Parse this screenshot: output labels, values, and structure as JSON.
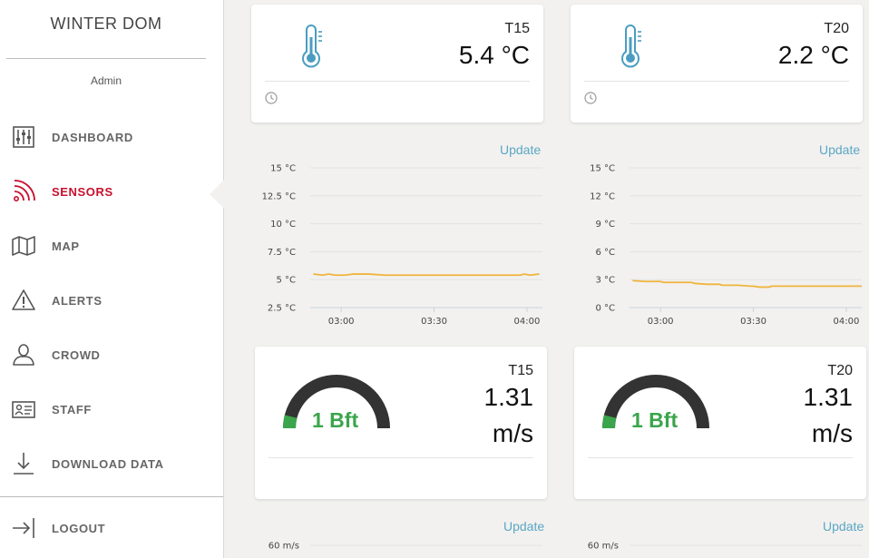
{
  "app": {
    "title": "WINTER DOM",
    "user": "Admin"
  },
  "nav": {
    "dashboard": "DASHBOARD",
    "sensors": "SENSORS",
    "map": "MAP",
    "alerts": "ALERTS",
    "crowd": "CROWD",
    "staff": "STAFF",
    "download": "DOWNLOAD DATA",
    "logout": "LOGOUT"
  },
  "colors": {
    "accent": "#c8102e",
    "link": "#5aa7c5",
    "thermo": "#4a9dc1",
    "line": "#f0b43c",
    "gauge_fill": "#3aa54b",
    "gauge_track": "#333333"
  },
  "temp_cards": [
    {
      "sensor": "T15",
      "value": "5.4 °C"
    },
    {
      "sensor": "T20",
      "value": "2.2 °C"
    }
  ],
  "wind_cards": [
    {
      "sensor": "T15",
      "gauge_label": "1 Bft",
      "value": "1.31",
      "unit": "m/s",
      "gauge_fraction": 0.08
    },
    {
      "sensor": "T20",
      "gauge_label": "1 Bft",
      "value": "1.31",
      "unit": "m/s",
      "gauge_fraction": 0.08
    }
  ],
  "update_label": "Update",
  "chart_data": [
    {
      "type": "line",
      "y_ticks": [
        "15 °C",
        "12.5 °C",
        "10 °C",
        "7.5 °C",
        "5 °C",
        "2.5 °C"
      ],
      "y_tick_values": [
        15,
        12.5,
        10,
        7.5,
        5,
        2.5
      ],
      "x_ticks": [
        "03:00",
        "03:30",
        "04:00"
      ],
      "x_tick_minutes": [
        180,
        210,
        240
      ],
      "xlim_minutes": [
        170,
        245
      ],
      "ylim": [
        2.5,
        15
      ],
      "grid": true,
      "series": [
        {
          "x_minutes": [
            171,
            174,
            176,
            178,
            181,
            184,
            189,
            194,
            200,
            215,
            230,
            238,
            239,
            241,
            244
          ],
          "values": [
            5.5,
            5.4,
            5.5,
            5.4,
            5.4,
            5.5,
            5.5,
            5.4,
            5.4,
            5.4,
            5.4,
            5.4,
            5.5,
            5.4,
            5.5
          ]
        }
      ]
    },
    {
      "type": "line",
      "y_ticks": [
        "15 °C",
        "12 °C",
        "9 °C",
        "6 °C",
        "3 °C",
        "0 °C"
      ],
      "y_tick_values": [
        15,
        12,
        9,
        6,
        3,
        0
      ],
      "x_ticks": [
        "03:00",
        "03:30",
        "04:00"
      ],
      "x_tick_minutes": [
        180,
        210,
        240
      ],
      "xlim_minutes": [
        170,
        245
      ],
      "ylim": [
        0,
        15
      ],
      "grid": true,
      "series": [
        {
          "x_minutes": [
            171,
            175,
            180,
            181,
            190,
            191,
            195,
            199,
            200,
            205,
            209,
            210,
            212,
            215,
            216,
            230,
            245
          ],
          "values": [
            2.9,
            2.8,
            2.8,
            2.7,
            2.7,
            2.6,
            2.5,
            2.5,
            2.4,
            2.4,
            2.3,
            2.3,
            2.2,
            2.2,
            2.3,
            2.3,
            2.3
          ]
        }
      ]
    },
    {
      "type": "line",
      "y_ticks": [
        "60 m/s"
      ],
      "y_tick_values": [
        60
      ],
      "ylim": [
        0,
        60
      ],
      "grid": true
    },
    {
      "type": "line",
      "y_ticks": [
        "60 m/s"
      ],
      "y_tick_values": [
        60
      ],
      "ylim": [
        0,
        60
      ],
      "grid": true
    }
  ]
}
